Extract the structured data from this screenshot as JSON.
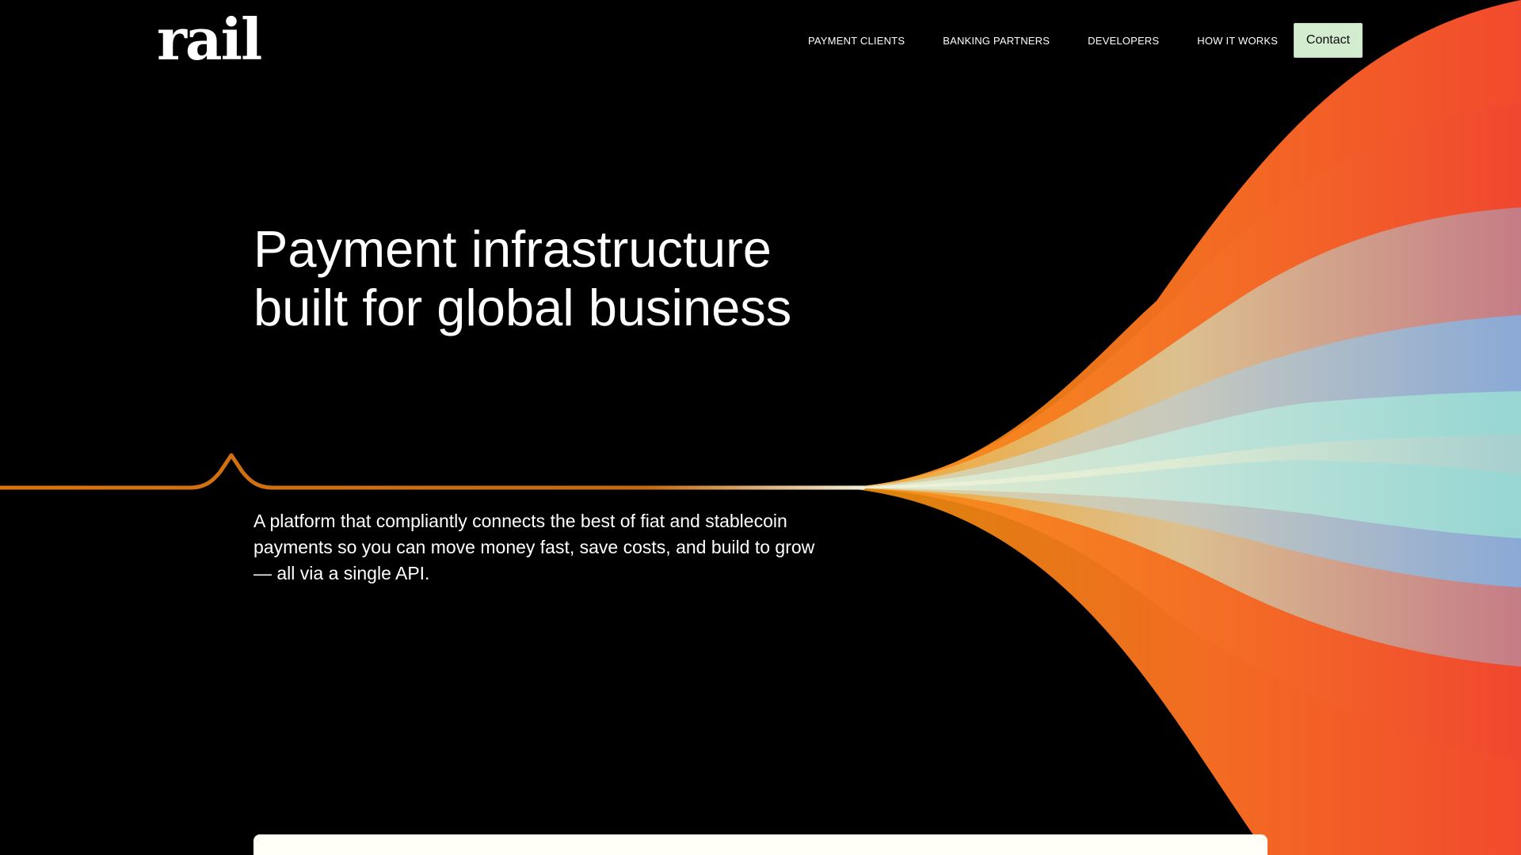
{
  "brand": {
    "logo_text": "rail"
  },
  "nav": {
    "items": [
      {
        "label": "PAYMENT CLIENTS"
      },
      {
        "label": "BANKING PARTNERS"
      },
      {
        "label": "DEVELOPERS"
      },
      {
        "label": "HOW IT WORKS"
      }
    ],
    "contact_label": "Contact"
  },
  "hero": {
    "title_line1": "Payment infrastructure",
    "title_line2": "built for global business",
    "description": "A platform that compliantly connects the best of fiat and stablecoin payments so you can move money fast, save costs, and build to grow — all via a single API."
  },
  "colors": {
    "background": "#000000",
    "contact_bg": "#d3ecd0",
    "line_orange": "#d9740f",
    "stream_orange": "#f7931e",
    "stream_red": "#f24a2e",
    "stream_blue": "#8fb4d9",
    "stream_teal": "#9cd9d3",
    "stream_cream": "#e6f0d0",
    "card_bg": "#fffff7"
  }
}
